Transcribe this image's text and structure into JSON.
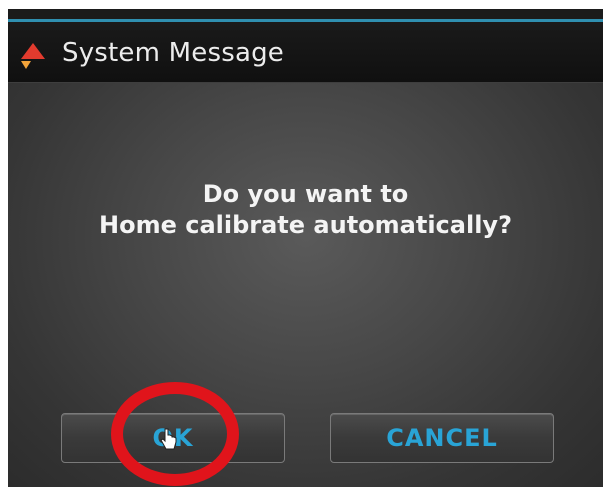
{
  "dialog": {
    "title": "System Message",
    "logo_icon": "red-triangle-logo-icon",
    "message_lines": [
      "Do you want to",
      "Home calibrate automatically?"
    ],
    "buttons": {
      "ok_label": "OK",
      "cancel_label": "CANCEL"
    }
  },
  "annotation": {
    "highlight_shape": "red-circle",
    "highlight_color": "#e0141b",
    "pointer_icon": "hand-pointer-icon"
  },
  "colors": {
    "accent": "#2f8fb0",
    "button_text": "#29a4d6",
    "logo_red": "#e23b2e",
    "logo_orange": "#f2a33a"
  }
}
